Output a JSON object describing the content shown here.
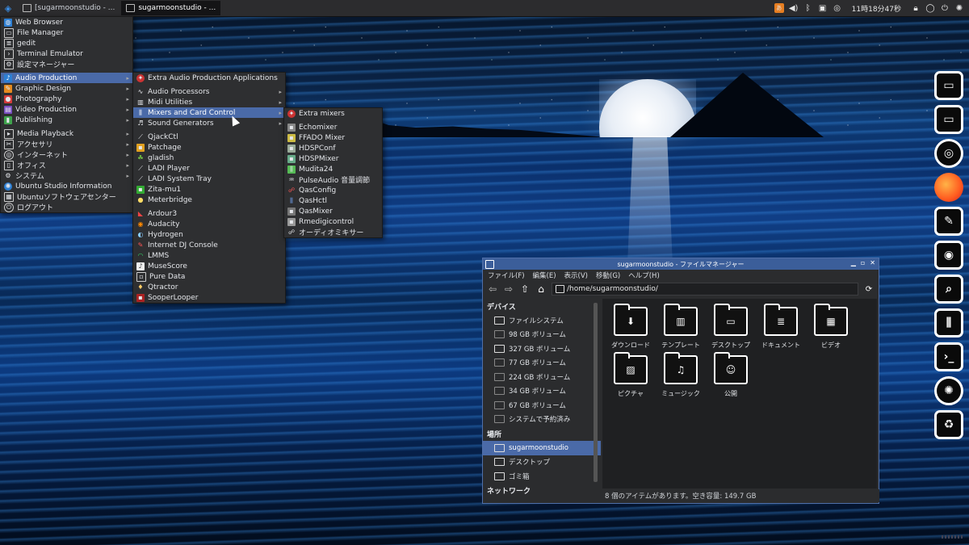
{
  "panel": {
    "tasks": [
      {
        "label": "[sugarmoonstudio - ...",
        "active": false
      },
      {
        "label": "sugarmoonstudio - ...",
        "active": true
      }
    ],
    "clock": "11時18分47秒"
  },
  "menu_main": {
    "items": [
      {
        "label": "Web Browser",
        "icon": "globe-icon",
        "submenu": false
      },
      {
        "label": "File Manager",
        "icon": "folder-icon",
        "submenu": false
      },
      {
        "label": "gedit",
        "icon": "text-editor-icon",
        "submenu": false
      },
      {
        "label": "Terminal Emulator",
        "icon": "terminal-icon",
        "submenu": false
      },
      {
        "label": "設定マネージャー",
        "icon": "settings-icon",
        "submenu": false
      },
      {
        "label": "Audio Production",
        "icon": "music-note-icon",
        "submenu": true,
        "highlighted": true
      },
      {
        "label": "Graphic Design",
        "icon": "palette-icon",
        "submenu": true
      },
      {
        "label": "Photography",
        "icon": "camera-icon",
        "submenu": true
      },
      {
        "label": "Video Production",
        "icon": "film-icon",
        "submenu": true
      },
      {
        "label": "Publishing",
        "icon": "book-icon",
        "submenu": true
      },
      {
        "label": "Media Playback",
        "icon": "play-icon",
        "submenu": true
      },
      {
        "label": "アクセサリ",
        "icon": "accessories-icon",
        "submenu": true
      },
      {
        "label": "インターネット",
        "icon": "internet-icon",
        "submenu": true
      },
      {
        "label": "オフィス",
        "icon": "office-icon",
        "submenu": true
      },
      {
        "label": "システム",
        "icon": "system-icon",
        "submenu": true
      },
      {
        "label": "Ubuntu Studio Information",
        "icon": "ubuntu-icon",
        "submenu": false
      },
      {
        "label": "Ubuntuソフトウェアセンター",
        "icon": "software-center-icon",
        "submenu": false
      },
      {
        "label": "ログアウト",
        "icon": "logout-icon",
        "submenu": false
      }
    ]
  },
  "menu_audio": {
    "items": [
      {
        "label": "Extra Audio Production Applications",
        "icon": "extra-apps-icon",
        "submenu": false
      },
      {
        "label": "Audio Processors",
        "icon": "audio-processor-icon",
        "submenu": true
      },
      {
        "label": "Midi Utilities",
        "icon": "midi-icon",
        "submenu": true
      },
      {
        "label": "Mixers and Card Control",
        "icon": "mixer-icon",
        "submenu": true,
        "highlighted": true
      },
      {
        "label": "Sound Generators",
        "icon": "sound-generator-icon",
        "submenu": true
      },
      {
        "label": "QjackCtl",
        "icon": "qjackctl-icon"
      },
      {
        "label": "Patchage",
        "icon": "patchage-icon"
      },
      {
        "label": "gladish",
        "icon": "gladish-icon"
      },
      {
        "label": "LADI Player",
        "icon": "ladi-player-icon"
      },
      {
        "label": "LADI System Tray",
        "icon": "ladi-tray-icon"
      },
      {
        "label": "Zita-mu1",
        "icon": "zita-icon"
      },
      {
        "label": "Meterbridge",
        "icon": "meterbridge-icon"
      },
      {
        "label": "Ardour3",
        "icon": "ardour-icon"
      },
      {
        "label": "Audacity",
        "icon": "audacity-icon"
      },
      {
        "label": "Hydrogen",
        "icon": "hydrogen-icon"
      },
      {
        "label": "Internet DJ Console",
        "icon": "idjc-icon"
      },
      {
        "label": "LMMS",
        "icon": "lmms-icon"
      },
      {
        "label": "MuseScore",
        "icon": "musescore-icon"
      },
      {
        "label": "Pure Data",
        "icon": "puredata-icon"
      },
      {
        "label": "Qtractor",
        "icon": "qtractor-icon"
      },
      {
        "label": "SooperLooper",
        "icon": "sooperlooper-icon"
      }
    ]
  },
  "menu_mixers": {
    "items": [
      {
        "label": "Extra mixers",
        "icon": "extra-mixers-icon"
      },
      {
        "label": "Echomixer",
        "icon": "echomixer-icon"
      },
      {
        "label": "FFADO Mixer",
        "icon": "ffado-icon"
      },
      {
        "label": "HDSPConf",
        "icon": "hdspconf-icon"
      },
      {
        "label": "HDSPMixer",
        "icon": "hdspmixer-icon"
      },
      {
        "label": "Mudita24",
        "icon": "mudita-icon"
      },
      {
        "label": "PulseAudio 音量調節",
        "icon": "pulseaudio-icon"
      },
      {
        "label": "QasConfig",
        "icon": "qasconfig-icon"
      },
      {
        "label": "QasHctl",
        "icon": "qashctl-icon"
      },
      {
        "label": "QasMixer",
        "icon": "qasmixer-icon"
      },
      {
        "label": "Rmedigicontrol",
        "icon": "rmedigi-icon"
      },
      {
        "label": "オーディオミキサー",
        "icon": "audio-mixer-icon"
      }
    ]
  },
  "file_manager": {
    "title": "sugarmoonstudio - ファイルマネージャー",
    "menubar": [
      "ファイル(F)",
      "編集(E)",
      "表示(V)",
      "移動(G)",
      "ヘルプ(H)"
    ],
    "path": "/home/sugarmoonstudio/",
    "sections": {
      "devices": "デバイス",
      "places": "場所",
      "network": "ネットワーク"
    },
    "devices": [
      "ファイルシステム",
      "98 GB ボリューム",
      "327 GB ボリューム",
      "77 GB ボリューム",
      "224 GB ボリューム",
      "34 GB ボリューム",
      "67 GB ボリューム",
      "システムで予約済み"
    ],
    "places": [
      "sugarmoonstudio",
      "デスクトップ",
      "ゴミ箱"
    ],
    "files": [
      {
        "label": "ダウンロード",
        "glyph": "⬇"
      },
      {
        "label": "テンプレート",
        "glyph": "▥"
      },
      {
        "label": "デスクトップ",
        "glyph": "▭"
      },
      {
        "label": "ドキュメント",
        "glyph": "≣"
      },
      {
        "label": "ビデオ",
        "glyph": "▦"
      },
      {
        "label": "ピクチャ",
        "glyph": "▨"
      },
      {
        "label": "ミュージック",
        "glyph": "♫"
      },
      {
        "label": "公開",
        "glyph": "☺"
      }
    ],
    "status": "8 個のアイテムがあります。空き容量: 149.7 GB"
  },
  "dock": {
    "items": [
      "desktop-icon",
      "folder-icon",
      "chrome-icon",
      "firefox-icon",
      "text-editor-icon",
      "camera-icon",
      "search-icon",
      "mixer-icon",
      "terminal-icon",
      "ubuntu-icon",
      "trash-icon"
    ]
  }
}
